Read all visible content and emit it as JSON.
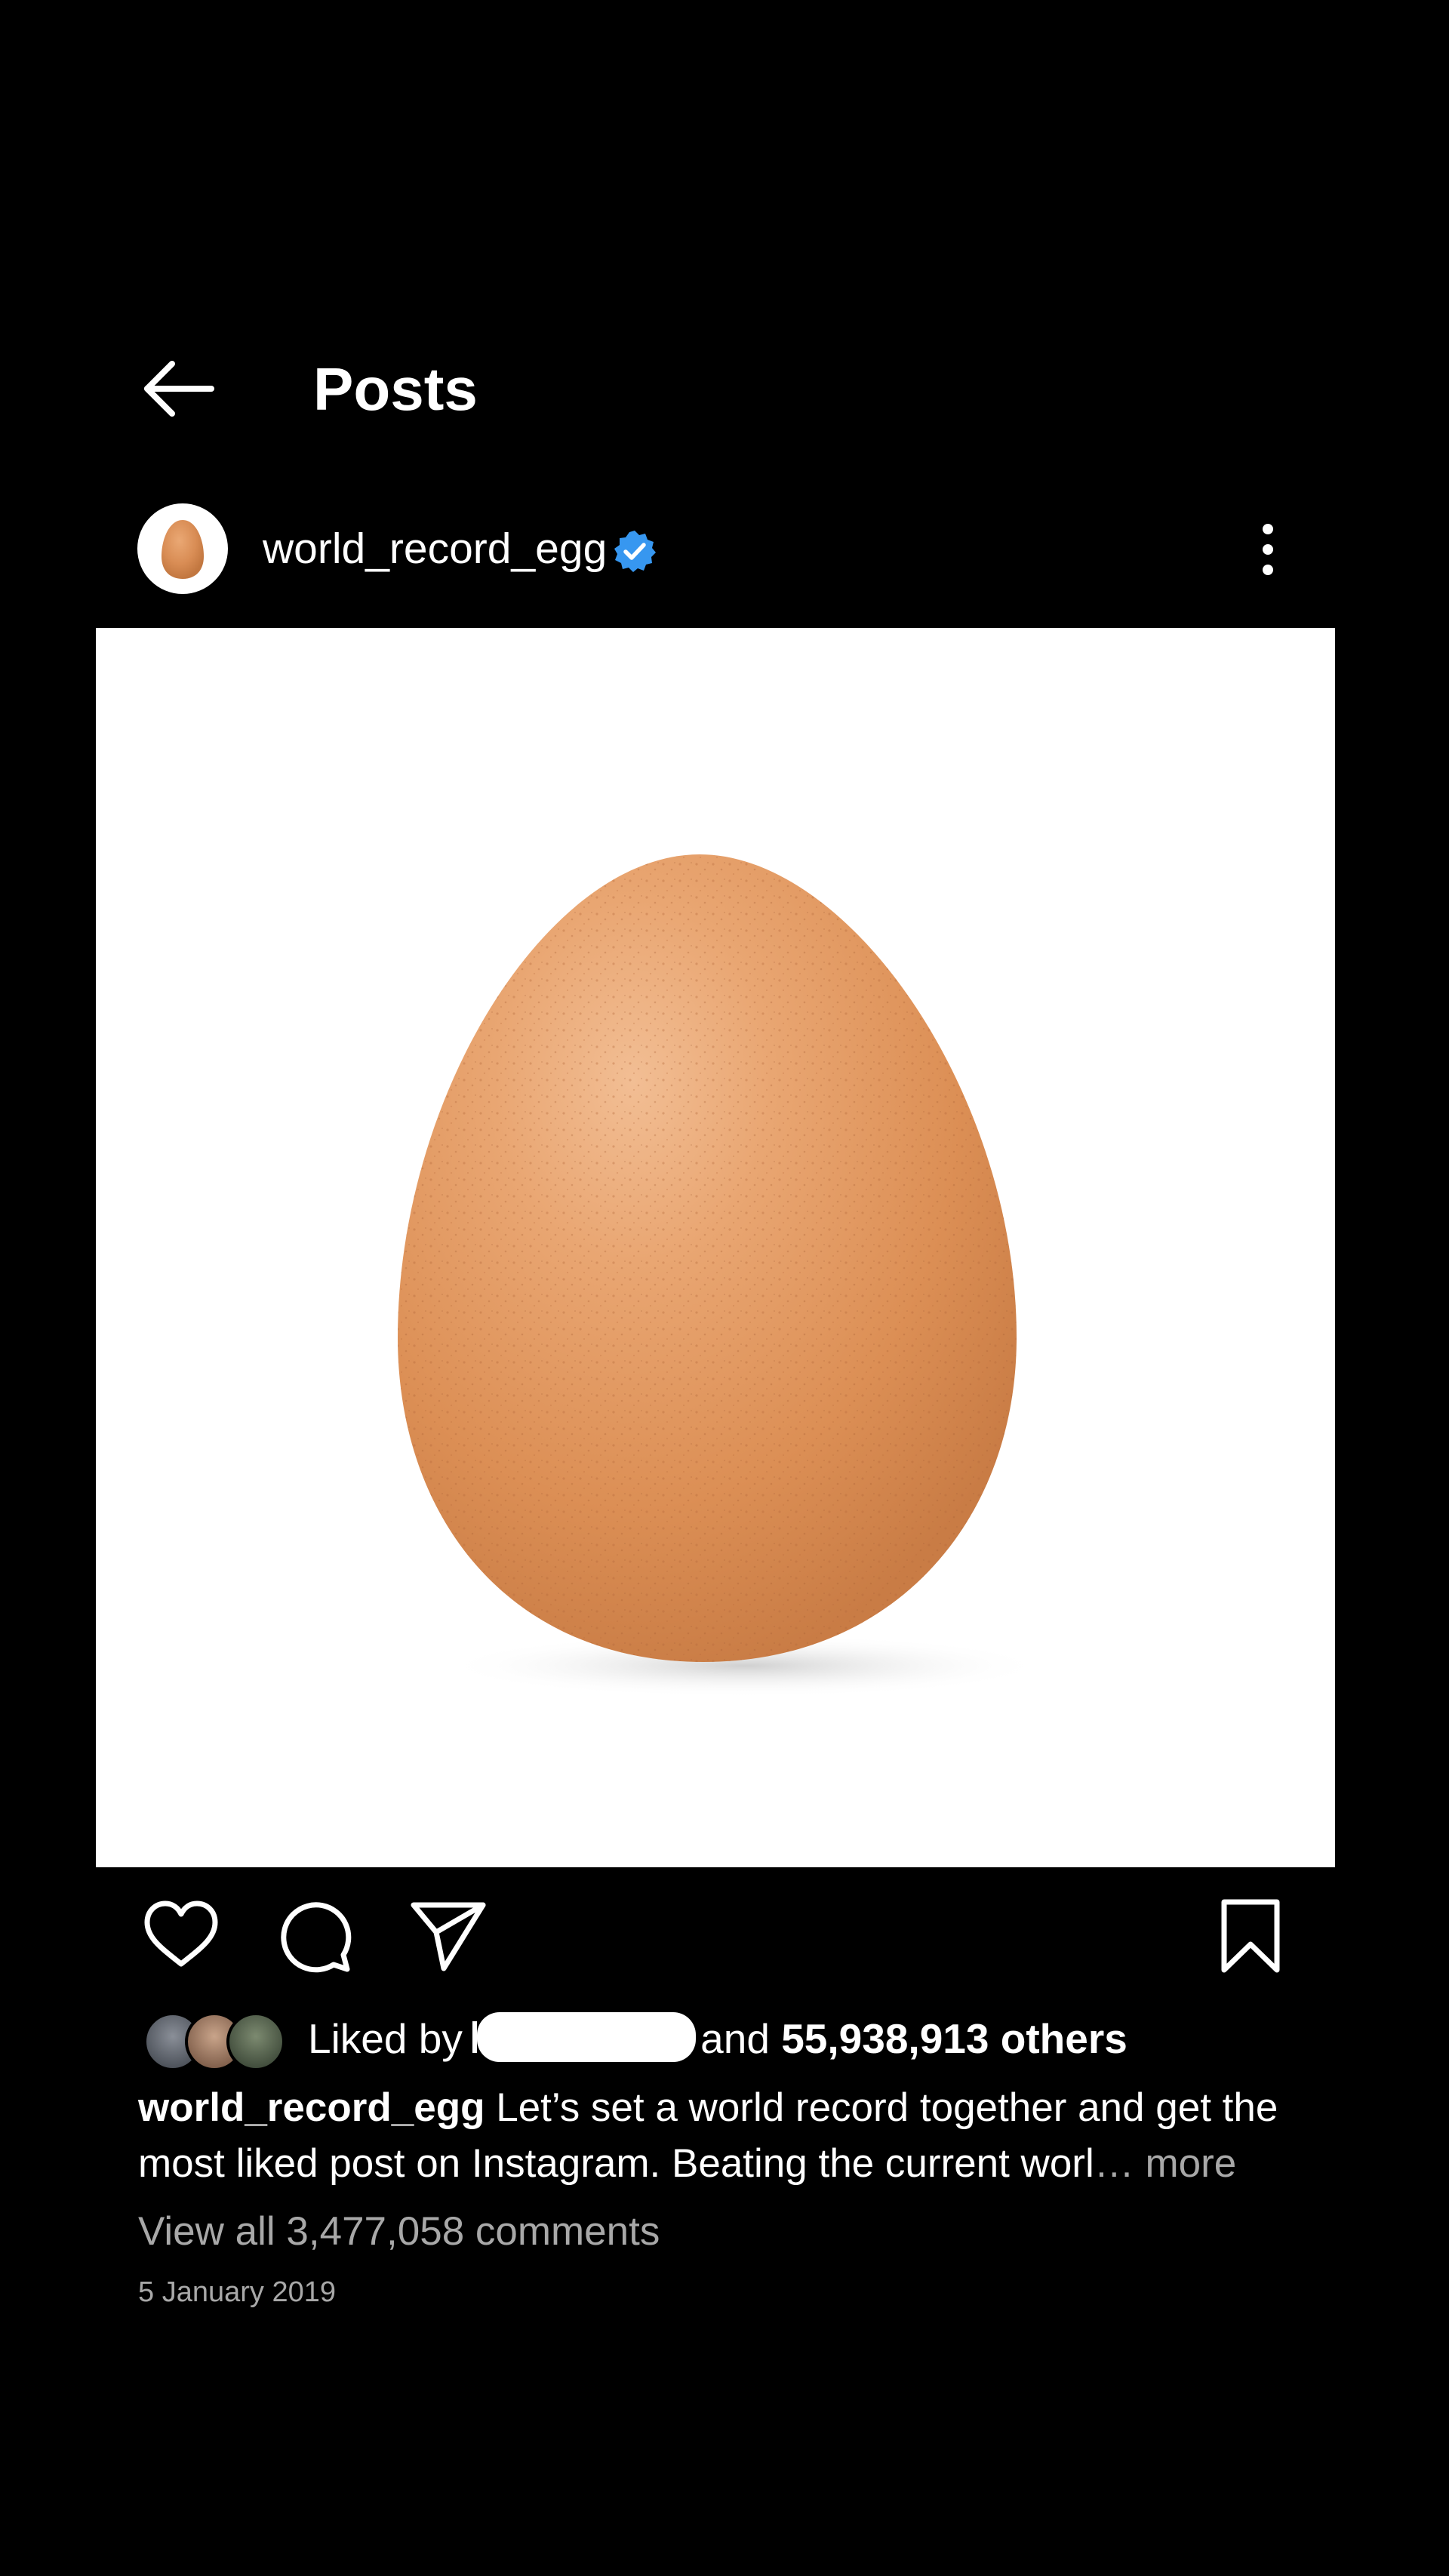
{
  "header": {
    "title": "Posts",
    "back_icon": "arrow-left-icon"
  },
  "post": {
    "username": "world_record_egg",
    "verified_color": "#3797f0",
    "more_icon": "more-vertical-icon",
    "image_subject": "egg",
    "actions": {
      "like_icon": "heart-icon",
      "comment_icon": "comment-icon",
      "share_icon": "send-icon",
      "save_icon": "bookmark-icon"
    },
    "likes": {
      "prefix": "Liked by",
      "connector": "and",
      "count_text": "55,938,913 others"
    },
    "caption": {
      "username": "world_record_egg",
      "text": "Let’s set a world record together and get the most liked post on Instagram. Beating the current worl",
      "ellipsis": "…",
      "more_label": "more"
    },
    "comments_label": "View all 3,477,058 comments",
    "date": "5 January 2019"
  }
}
